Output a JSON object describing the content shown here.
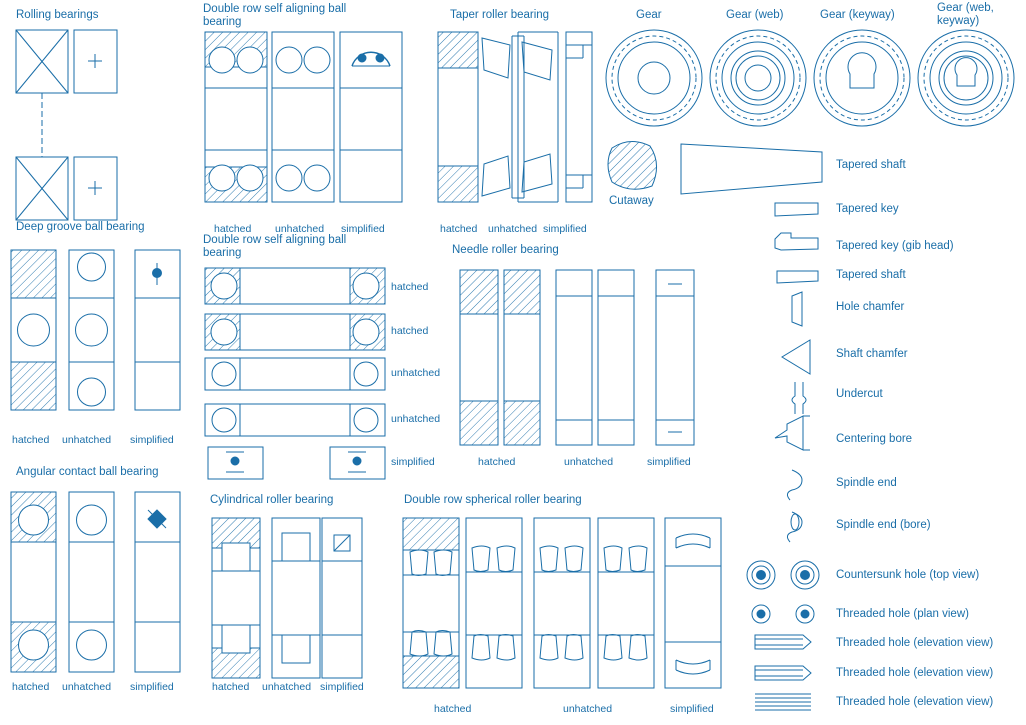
{
  "groups": [
    {
      "id": "rolling-bearings",
      "title": "Rolling bearings"
    },
    {
      "id": "deep-groove",
      "title": "Deep groove ball bearing"
    },
    {
      "id": "angular-contact",
      "title": "Angular contact ball bearing"
    },
    {
      "id": "double-row-self-aligning-1",
      "title": "Double row self aligning ball bearing"
    },
    {
      "id": "double-row-self-aligning-2",
      "title": "Double row self aligning ball bearing"
    },
    {
      "id": "cylindrical-roller",
      "title": "Cylindrical roller bearing"
    },
    {
      "id": "taper-roller",
      "title": "Taper roller bearing"
    },
    {
      "id": "needle-roller",
      "title": "Needle roller bearing"
    },
    {
      "id": "double-row-spherical",
      "title": "Double row spherical roller bearing"
    }
  ],
  "variant_labels": {
    "hatched": "hatched",
    "unhatched": "unhatched",
    "simplified": "simplified"
  },
  "gears": [
    {
      "label": "Gear"
    },
    {
      "label": "Gear (web)"
    },
    {
      "label": "Gear (keyway)"
    },
    {
      "label": "Gear (web, keyway)"
    }
  ],
  "cutaway": {
    "label": "Cutaway"
  },
  "shaft_items": [
    {
      "label": "Tapered shaft"
    },
    {
      "label": "Tapered key"
    },
    {
      "label": "Tapered key (gib head)"
    },
    {
      "label": "Tapered shaft"
    },
    {
      "label": "Hole chamfer"
    },
    {
      "label": "Shaft chamfer"
    },
    {
      "label": "Undercut"
    },
    {
      "label": "Centering bore"
    },
    {
      "label": "Spindle end"
    },
    {
      "label": "Spindle end (bore)"
    },
    {
      "label": "Countersunk hole (top view)"
    },
    {
      "label": "Threaded hole (plan view)"
    },
    {
      "label": "Threaded hole (elevation view)"
    },
    {
      "label": "Threaded hole (elevation view)"
    },
    {
      "label": "Threaded hole (elevation view)"
    }
  ],
  "colors": {
    "line": "#1a6ea8",
    "text": "#1a6ea8",
    "background": "#ffffff"
  }
}
